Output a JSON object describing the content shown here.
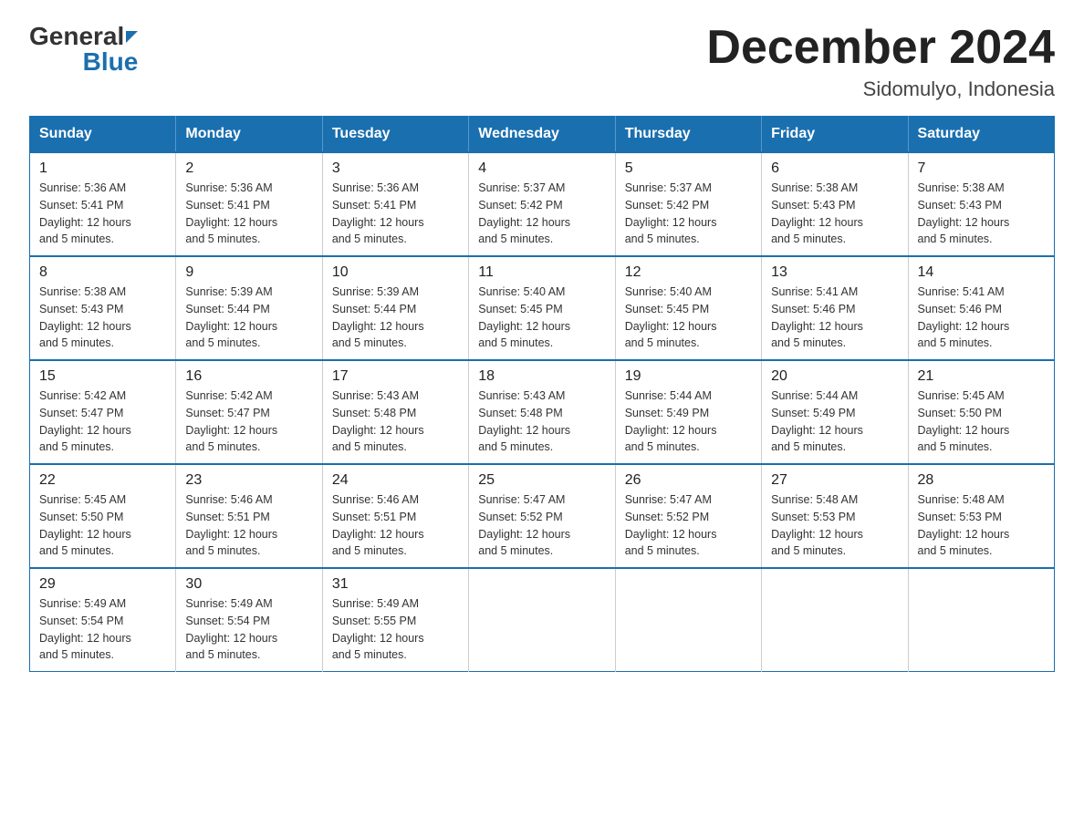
{
  "header": {
    "logo_general": "General",
    "logo_blue": "Blue",
    "title": "December 2024",
    "subtitle": "Sidomulyo, Indonesia"
  },
  "days_of_week": [
    "Sunday",
    "Monday",
    "Tuesday",
    "Wednesday",
    "Thursday",
    "Friday",
    "Saturday"
  ],
  "weeks": [
    [
      {
        "day": "1",
        "sunrise": "5:36 AM",
        "sunset": "5:41 PM",
        "daylight": "12 hours and 5 minutes."
      },
      {
        "day": "2",
        "sunrise": "5:36 AM",
        "sunset": "5:41 PM",
        "daylight": "12 hours and 5 minutes."
      },
      {
        "day": "3",
        "sunrise": "5:36 AM",
        "sunset": "5:41 PM",
        "daylight": "12 hours and 5 minutes."
      },
      {
        "day": "4",
        "sunrise": "5:37 AM",
        "sunset": "5:42 PM",
        "daylight": "12 hours and 5 minutes."
      },
      {
        "day": "5",
        "sunrise": "5:37 AM",
        "sunset": "5:42 PM",
        "daylight": "12 hours and 5 minutes."
      },
      {
        "day": "6",
        "sunrise": "5:38 AM",
        "sunset": "5:43 PM",
        "daylight": "12 hours and 5 minutes."
      },
      {
        "day": "7",
        "sunrise": "5:38 AM",
        "sunset": "5:43 PM",
        "daylight": "12 hours and 5 minutes."
      }
    ],
    [
      {
        "day": "8",
        "sunrise": "5:38 AM",
        "sunset": "5:43 PM",
        "daylight": "12 hours and 5 minutes."
      },
      {
        "day": "9",
        "sunrise": "5:39 AM",
        "sunset": "5:44 PM",
        "daylight": "12 hours and 5 minutes."
      },
      {
        "day": "10",
        "sunrise": "5:39 AM",
        "sunset": "5:44 PM",
        "daylight": "12 hours and 5 minutes."
      },
      {
        "day": "11",
        "sunrise": "5:40 AM",
        "sunset": "5:45 PM",
        "daylight": "12 hours and 5 minutes."
      },
      {
        "day": "12",
        "sunrise": "5:40 AM",
        "sunset": "5:45 PM",
        "daylight": "12 hours and 5 minutes."
      },
      {
        "day": "13",
        "sunrise": "5:41 AM",
        "sunset": "5:46 PM",
        "daylight": "12 hours and 5 minutes."
      },
      {
        "day": "14",
        "sunrise": "5:41 AM",
        "sunset": "5:46 PM",
        "daylight": "12 hours and 5 minutes."
      }
    ],
    [
      {
        "day": "15",
        "sunrise": "5:42 AM",
        "sunset": "5:47 PM",
        "daylight": "12 hours and 5 minutes."
      },
      {
        "day": "16",
        "sunrise": "5:42 AM",
        "sunset": "5:47 PM",
        "daylight": "12 hours and 5 minutes."
      },
      {
        "day": "17",
        "sunrise": "5:43 AM",
        "sunset": "5:48 PM",
        "daylight": "12 hours and 5 minutes."
      },
      {
        "day": "18",
        "sunrise": "5:43 AM",
        "sunset": "5:48 PM",
        "daylight": "12 hours and 5 minutes."
      },
      {
        "day": "19",
        "sunrise": "5:44 AM",
        "sunset": "5:49 PM",
        "daylight": "12 hours and 5 minutes."
      },
      {
        "day": "20",
        "sunrise": "5:44 AM",
        "sunset": "5:49 PM",
        "daylight": "12 hours and 5 minutes."
      },
      {
        "day": "21",
        "sunrise": "5:45 AM",
        "sunset": "5:50 PM",
        "daylight": "12 hours and 5 minutes."
      }
    ],
    [
      {
        "day": "22",
        "sunrise": "5:45 AM",
        "sunset": "5:50 PM",
        "daylight": "12 hours and 5 minutes."
      },
      {
        "day": "23",
        "sunrise": "5:46 AM",
        "sunset": "5:51 PM",
        "daylight": "12 hours and 5 minutes."
      },
      {
        "day": "24",
        "sunrise": "5:46 AM",
        "sunset": "5:51 PM",
        "daylight": "12 hours and 5 minutes."
      },
      {
        "day": "25",
        "sunrise": "5:47 AM",
        "sunset": "5:52 PM",
        "daylight": "12 hours and 5 minutes."
      },
      {
        "day": "26",
        "sunrise": "5:47 AM",
        "sunset": "5:52 PM",
        "daylight": "12 hours and 5 minutes."
      },
      {
        "day": "27",
        "sunrise": "5:48 AM",
        "sunset": "5:53 PM",
        "daylight": "12 hours and 5 minutes."
      },
      {
        "day": "28",
        "sunrise": "5:48 AM",
        "sunset": "5:53 PM",
        "daylight": "12 hours and 5 minutes."
      }
    ],
    [
      {
        "day": "29",
        "sunrise": "5:49 AM",
        "sunset": "5:54 PM",
        "daylight": "12 hours and 5 minutes."
      },
      {
        "day": "30",
        "sunrise": "5:49 AM",
        "sunset": "5:54 PM",
        "daylight": "12 hours and 5 minutes."
      },
      {
        "day": "31",
        "sunrise": "5:49 AM",
        "sunset": "5:55 PM",
        "daylight": "12 hours and 5 minutes."
      },
      null,
      null,
      null,
      null
    ]
  ],
  "labels": {
    "sunrise": "Sunrise:",
    "sunset": "Sunset:",
    "daylight": "Daylight:"
  }
}
